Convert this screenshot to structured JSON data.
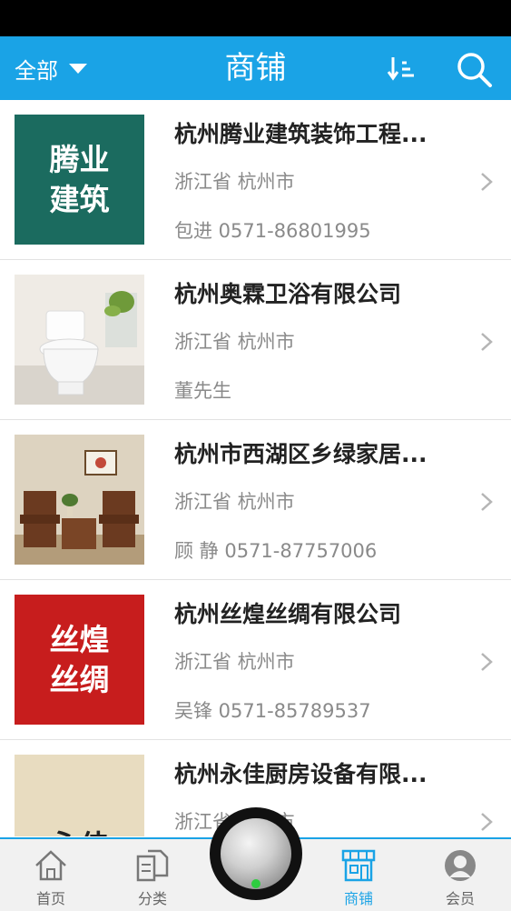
{
  "header": {
    "filter_label": "全部",
    "title": "商铺",
    "bg_color": "#1aa3e6"
  },
  "shops": [
    {
      "name": "杭州腾业建筑装饰工程...",
      "region": "浙江省 杭州市",
      "contact": "包进 0571-86801995",
      "thumb_text": "腾业\n建筑",
      "thumb_color": "#1b6b5f"
    },
    {
      "name": "杭州奥霖卫浴有限公司",
      "region": "浙江省 杭州市",
      "contact": "董先生",
      "thumb_icon": "toilet-photo"
    },
    {
      "name": "杭州市西湖区乡绿家居...",
      "region": "浙江省 杭州市",
      "contact": "顾 静 0571-87757006",
      "thumb_icon": "furniture-photo"
    },
    {
      "name": "杭州丝煌丝绸有限公司",
      "region": "浙江省 杭州市",
      "contact": "吴锋 0571-85789537",
      "thumb_text": "丝煌\n丝绸",
      "thumb_color": "#c71d1d"
    },
    {
      "name": "杭州永佳厨房设备有限...",
      "region": "浙江省 杭州市",
      "contact": "",
      "thumb_text": "永佳",
      "thumb_color": "#e8dcc0"
    }
  ],
  "tabs": [
    {
      "label": "首页",
      "icon": "home-icon"
    },
    {
      "label": "分类",
      "icon": "category-icon"
    },
    {
      "label": "商铺",
      "icon": "store-icon",
      "active": true
    },
    {
      "label": "会员",
      "icon": "member-icon"
    }
  ],
  "colors": {
    "accent": "#1aa3e6",
    "text_secondary": "#8a8a8a"
  }
}
